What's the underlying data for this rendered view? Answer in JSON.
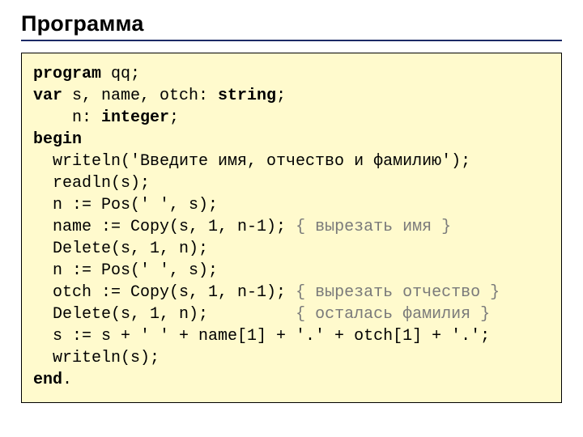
{
  "title": "Программа",
  "code": {
    "l1a": "program",
    "l1b": " qq;",
    "l2a": "var",
    "l2b": " s, name, otch: ",
    "l2c": "string",
    "l2d": ";",
    "l3a": "    n: ",
    "l3b": "integer",
    "l3c": ";",
    "l4a": "begin",
    "l5": "  writeln('Введите имя, отчество и фамилию');",
    "l6": "  readln(s);",
    "l7": "  n := Pos(' ', s);",
    "l8a": "  name := Copy(s, 1, n-1); ",
    "l8b": "{ вырезать имя }",
    "l9": "  Delete(s, 1, n);",
    "l10": "  n := Pos(' ', s);",
    "l11a": "  otch := Copy(s, 1, n-1); ",
    "l11b": "{ вырезать отчество }",
    "l12a": "  Delete(s, 1, n);         ",
    "l12b": "{ осталась фамилия }",
    "l13": "  s := s + ' ' + name[1] + '.' + otch[1] + '.';",
    "l14": "  writeln(s);",
    "l15a": "end",
    "l15b": "."
  }
}
